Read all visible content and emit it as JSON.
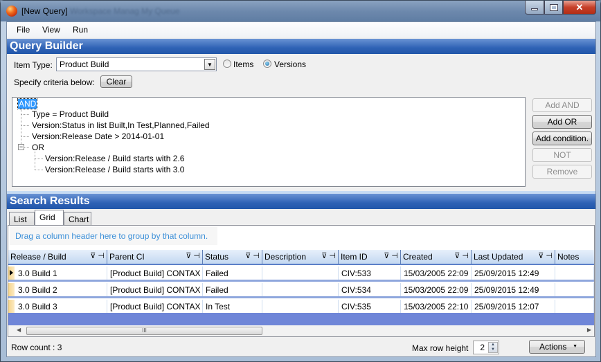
{
  "window": {
    "title": "[New Query]",
    "background_title": "Workspace  Manag    My Queue",
    "controls": {
      "minimize": "minimize",
      "maximize": "maximize",
      "close": "✕"
    }
  },
  "menu": [
    "File",
    "View",
    "Run"
  ],
  "query_builder": {
    "title": "Query Builder",
    "item_type_label": "Item Type:",
    "item_type_value": "Product Build",
    "radio_items_label": "Items",
    "radio_versions_label": "Versions",
    "selected_radio": "Versions",
    "criteria_label": "Specify criteria below:",
    "clear_label": "Clear",
    "tree": {
      "root": "AND",
      "conditions": [
        "Type = Product Build",
        "Version:Status in list Built,In Test,Planned,Failed",
        "Version:Release Date > 2014-01-01"
      ],
      "or_node": "OR",
      "or_conditions": [
        "Version:Release / Build starts with 2.6",
        "Version:Release / Build starts with 3.0"
      ]
    },
    "buttons": [
      {
        "label": "Add AND",
        "enabled": false
      },
      {
        "label": "Add OR",
        "enabled": true
      },
      {
        "label": "Add condition.",
        "enabled": true
      },
      {
        "label": "NOT",
        "enabled": false
      },
      {
        "label": "Remove",
        "enabled": false
      }
    ]
  },
  "search_results": {
    "title": "Search Results",
    "tabs": [
      "List",
      "Grid",
      "Chart"
    ],
    "active_tab": "Grid",
    "group_hint": "Drag a column header here to group by that column.",
    "columns": [
      "Release / Build",
      "Parent CI",
      "Status",
      "Description",
      "Item ID",
      "Created",
      "Last Updated",
      "Notes"
    ],
    "rows": [
      [
        "3.0 Build 1",
        "[Product Build] CONTAX",
        "Failed",
        "",
        "CIV:533",
        "15/03/2005 22:09",
        "25/09/2015 12:49",
        ""
      ],
      [
        "3.0 Build 2",
        "[Product Build] CONTAX",
        "Failed",
        "",
        "CIV:534",
        "15/03/2005 22:09",
        "25/09/2015 12:49",
        ""
      ],
      [
        "3.0 Build 3",
        "[Product Build] CONTAX",
        "In Test",
        "",
        "CIV:535",
        "15/03/2005 22:10",
        "25/09/2015 12:07",
        ""
      ]
    ],
    "row_count_label": "Row count : 3",
    "max_row_height_label": "Max row height",
    "max_row_height_value": "2",
    "actions_label": "Actions",
    "scroll_grip": "III"
  }
}
